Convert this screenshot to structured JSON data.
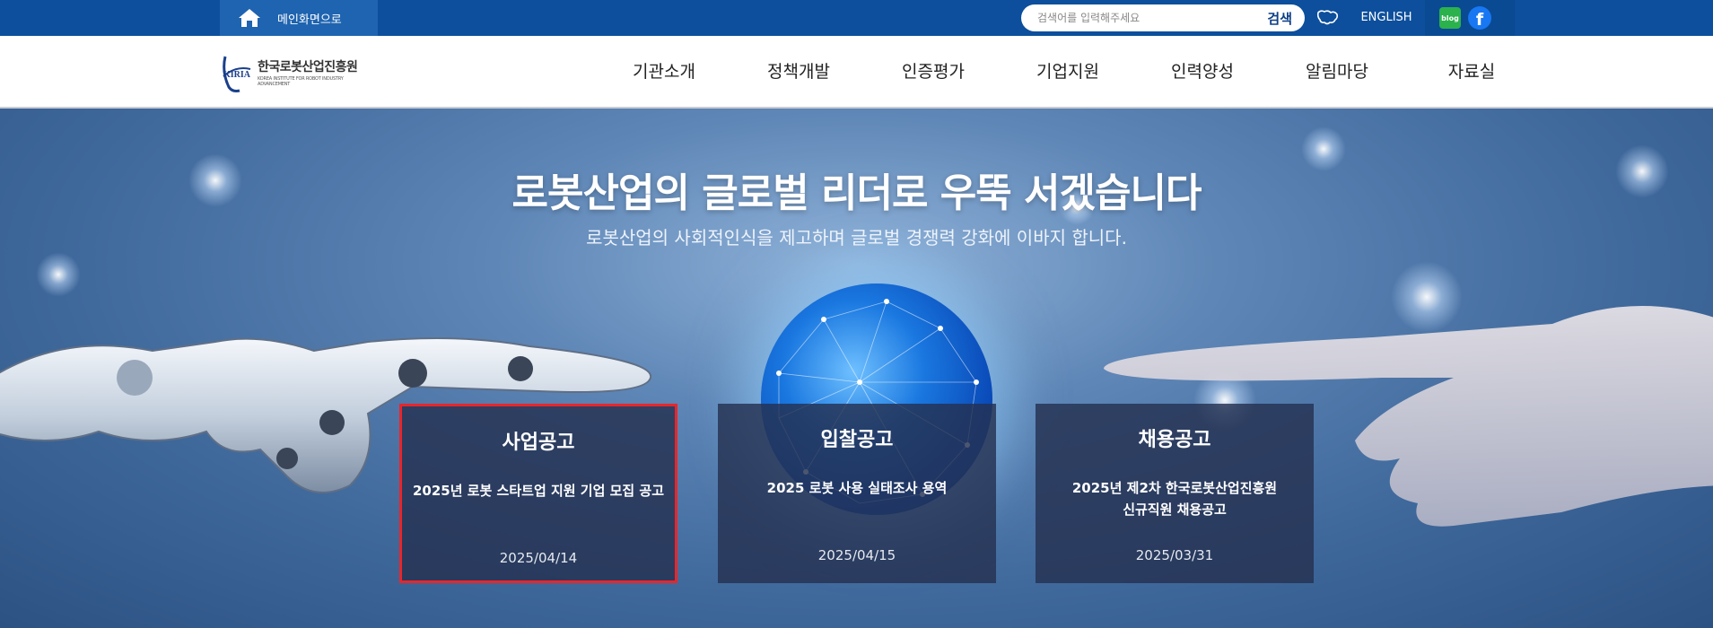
{
  "topbar": {
    "home_label": "메인화면으로",
    "search_placeholder": "검색어를 입력해주세요",
    "search_button": "검색",
    "english_label": "ENGLISH",
    "blog_label": "blog"
  },
  "header": {
    "logo_name": "한국로봇산업진흥원",
    "logo_abbr": "KIRIA",
    "logo_eng": "KOREA INSTITUTE FOR ROBOT INDUSTRY ADVANCEMENT",
    "nav": [
      "기관소개",
      "정책개발",
      "인증평가",
      "기업지원",
      "인력양성",
      "알림마당",
      "자료실"
    ]
  },
  "hero": {
    "title": "로봇산업의 글로벌 리더로 우뚝 서겠습니다",
    "subtitle": "로봇산업의 사회적인식을 제고하며 글로벌 경쟁력 강화에 이바지 합니다."
  },
  "cards": [
    {
      "title": "사업공고",
      "desc_line1": "2025년 로봇 스타트업 지원 기업 모집 공고",
      "desc_line2": "",
      "date": "2025/04/14",
      "active": true
    },
    {
      "title": "입찰공고",
      "desc_line1": "2025 로봇 사용 실태조사 용역",
      "desc_line2": "",
      "date": "2025/04/15",
      "active": false
    },
    {
      "title": "채용공고",
      "desc_line1": "2025년 제2차 한국로봇산업진흥원",
      "desc_line2": "신규직원 채용공고",
      "date": "2025/03/31",
      "active": false
    }
  ],
  "colors": {
    "topbar_bg": "#0d4f9c",
    "active_border": "#e8262b",
    "card_bg": "#243150"
  }
}
